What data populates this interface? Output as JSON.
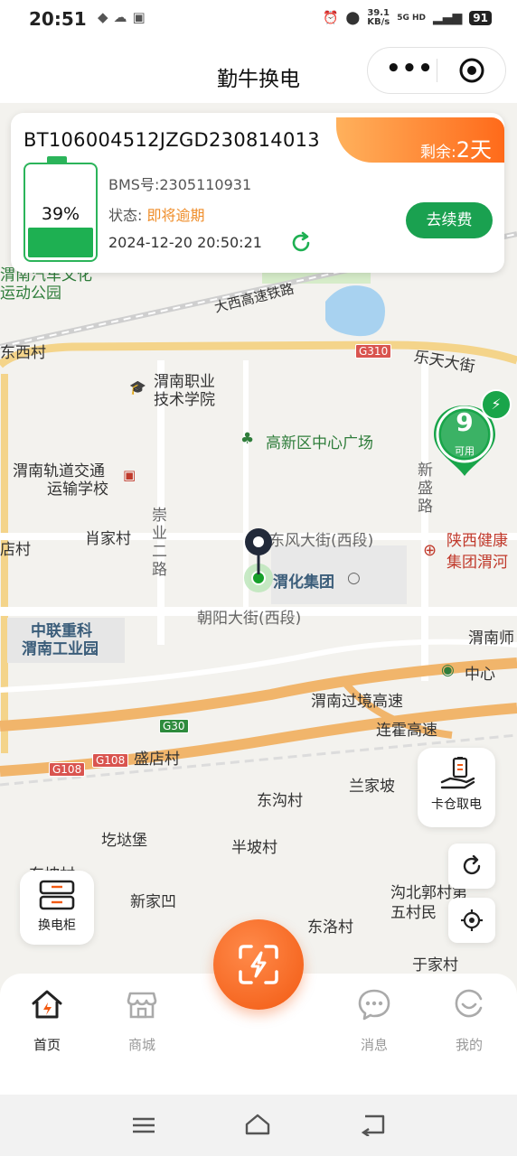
{
  "status_bar": {
    "time": "20:51",
    "net_speed": "39.1",
    "net_unit": "KB/s",
    "network": "5G HD",
    "battery": "91"
  },
  "header": {
    "title": "勤牛换电",
    "more_icon": "more-dots-icon",
    "close_icon": "target-circle-icon"
  },
  "battery_card": {
    "id": "BT106004512JZGD230814013",
    "remaining_label": "剩余:",
    "remaining_value": "2天",
    "percent": "39%",
    "percent_value": 39,
    "bms_label": "BMS号:",
    "bms_value": "2305110931",
    "status_label": "状态:",
    "status_value": "即将逾期",
    "timestamp": "2024-12-20 20:50:21",
    "renew_button": "去续费",
    "colors": {
      "accent_green": "#1aa150",
      "warn_orange": "#ef8d2a",
      "badge_orange": "#ff6a1a"
    }
  },
  "map": {
    "labels": {
      "l1": "渭南汽车文化",
      "l2": "运动公园",
      "l3": "大西高速铁路",
      "l4": "东西村",
      "l5": "乐天大街",
      "l6": "渭南职业",
      "l7": "技术学院",
      "l8": "高新区中心广场",
      "l9": "渭南轨道交通",
      "l10": "运输学校",
      "l11": "新",
      "l12": "盛",
      "l13": "路",
      "l14": "崇",
      "l15": "业",
      "l16": "二",
      "l17": "路",
      "l18": "肖家村",
      "l19": "店村",
      "l20": "东风大街(西段)",
      "l21": "陕西健康",
      "l22": "集团渭河",
      "l23": "渭化集团",
      "l24": "朝阳大街(西段)",
      "l25": "中联重科",
      "l26": "渭南工业园",
      "l27": "渭南师",
      "l28": "中心",
      "l29": "渭南过境高速",
      "l30": "连霍高速",
      "l31": "盛店村",
      "l32": "兰家坡",
      "l33": "东沟村",
      "l34": "圪垯堡",
      "l35": "半坡村",
      "l36": "新家凹",
      "l37": "沟北郭村第",
      "l38": "五村民",
      "l39": "东洛村",
      "l40": "于家村",
      "l41": "东坡村"
    },
    "road_tags": {
      "g310": "G310",
      "g30": "G30",
      "g108a": "G108",
      "g108b": "G108"
    },
    "station": {
      "count": "9",
      "label": "可用",
      "icon": "lightning-icon"
    }
  },
  "floating": {
    "cabin_pickup": "卡仓取电",
    "swap_cabinet": "换电柜"
  },
  "nav": {
    "home": "首页",
    "mall": "商城",
    "messages": "消息",
    "mine": "我的"
  }
}
